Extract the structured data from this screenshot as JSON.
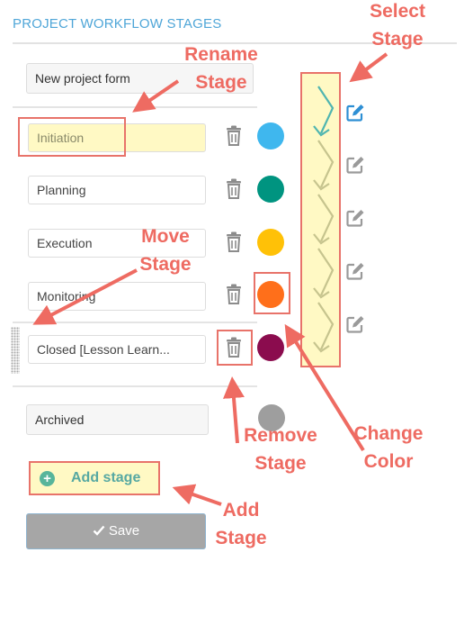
{
  "header": {
    "title": "PROJECT WORKFLOW STAGES"
  },
  "form_name": "New project form",
  "stages": [
    {
      "name": "Initiation",
      "color": "#3fb7ee"
    },
    {
      "name": "Planning",
      "color": "#009480"
    },
    {
      "name": "Execution",
      "color": "#ffc107"
    },
    {
      "name": "Monitoring",
      "color": "#ff6f1a"
    },
    {
      "name": "Closed [Lesson Learn...",
      "color": "#8b0c4e"
    }
  ],
  "archived": {
    "name": "Archived",
    "color": "#9e9e9e"
  },
  "add_stage_label": "Add stage",
  "save_label": "Save",
  "annotations": {
    "rename": [
      "Rename",
      "Stage"
    ],
    "select": [
      "Select",
      "Stage"
    ],
    "move": [
      "Move",
      "Stage"
    ],
    "remove": [
      "Remove",
      "Stage"
    ],
    "change": [
      "Change",
      "Color"
    ],
    "add": [
      "Add",
      "Stage"
    ]
  },
  "annotation_color": "#ee6b62",
  "icons": [
    "trash-icon",
    "pencil-edit-icon",
    "plus-circle-icon",
    "check-icon",
    "drag-handle-icon",
    "chevron-arrow-icon"
  ]
}
